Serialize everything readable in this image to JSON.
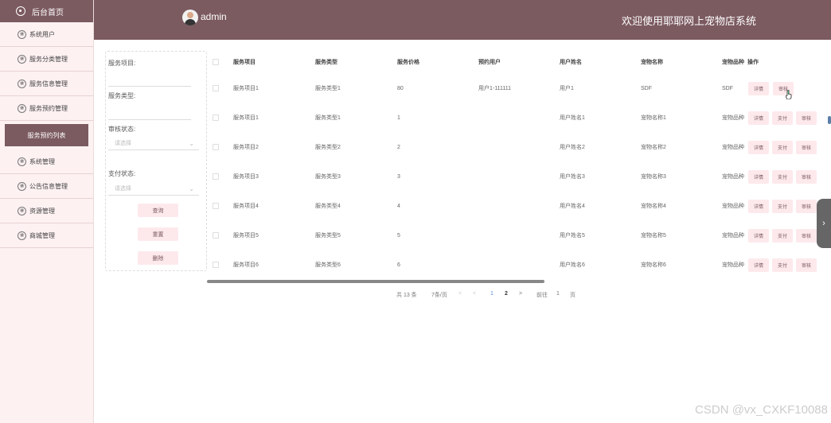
{
  "sidebar": {
    "home": "后台首页",
    "items": [
      {
        "label": "系统用户"
      },
      {
        "label": "服务分类管理"
      },
      {
        "label": "服务信息管理"
      },
      {
        "label": "服务预约管理"
      }
    ],
    "active_sub": "服务预约列表",
    "items2": [
      {
        "label": "系统管理"
      },
      {
        "label": "公告信息管理"
      },
      {
        "label": "资源管理"
      },
      {
        "label": "商城管理"
      }
    ]
  },
  "header": {
    "user": "admin",
    "title": "欢迎使用耶耶网上宠物店系统"
  },
  "filter": {
    "service_item_label": "服务项目:",
    "service_type_label": "服务类型:",
    "audit_status_label": "审核状态:",
    "audit_status_placeholder": "请选择",
    "pay_status_label": "支付状态:",
    "pay_status_placeholder": "请选择",
    "search_btn": "查询",
    "reset_btn": "重置",
    "delete_btn": "删除"
  },
  "table": {
    "headers": [
      "服务项目",
      "服务类型",
      "服务价格",
      "预约用户",
      "用户姓名",
      "宠物名称",
      "宠物品种",
      "操作"
    ],
    "rows": [
      {
        "item": "服务项目1",
        "type": "服务类型1",
        "price": "80",
        "user": "用户1-111111",
        "name": "用户1",
        "pet": "SDF",
        "breed": "SDF",
        "actions": [
          "详情",
          "审核"
        ]
      },
      {
        "item": "服务项目1",
        "type": "服务类型1",
        "price": "1",
        "user": "",
        "name": "用户姓名1",
        "pet": "宠物名称1",
        "breed": "宠物品种",
        "actions": [
          "详情",
          "支付",
          "审核"
        ]
      },
      {
        "item": "服务项目2",
        "type": "服务类型2",
        "price": "2",
        "user": "",
        "name": "用户姓名2",
        "pet": "宠物名称2",
        "breed": "宠物品种",
        "actions": [
          "详情",
          "支付",
          "审核"
        ]
      },
      {
        "item": "服务项目3",
        "type": "服务类型3",
        "price": "3",
        "user": "",
        "name": "用户姓名3",
        "pet": "宠物名称3",
        "breed": "宠物品种",
        "actions": [
          "详情",
          "支付",
          "审核"
        ]
      },
      {
        "item": "服务项目4",
        "type": "服务类型4",
        "price": "4",
        "user": "",
        "name": "用户姓名4",
        "pet": "宠物名称4",
        "breed": "宠物品种",
        "actions": [
          "详情",
          "支付",
          "审核"
        ]
      },
      {
        "item": "服务项目5",
        "type": "服务类型5",
        "price": "5",
        "user": "",
        "name": "用户姓名5",
        "pet": "宠物名称5",
        "breed": "宠物品种",
        "actions": [
          "详情",
          "支付",
          "审核"
        ]
      },
      {
        "item": "服务项目6",
        "type": "服务类型6",
        "price": "6",
        "user": "",
        "name": "用户姓名6",
        "pet": "宠物名称6",
        "breed": "宠物品种",
        "actions": [
          "详情",
          "支付",
          "审核"
        ]
      }
    ]
  },
  "pager": {
    "total": "共 13 条",
    "size": "7条/页",
    "prev": "<",
    "page1": "1",
    "page2": "2",
    "next": ">",
    "goto": "前往",
    "goto_value": "1",
    "page_unit": "页"
  },
  "watermark": "CSDN @vx_CXKF10088"
}
